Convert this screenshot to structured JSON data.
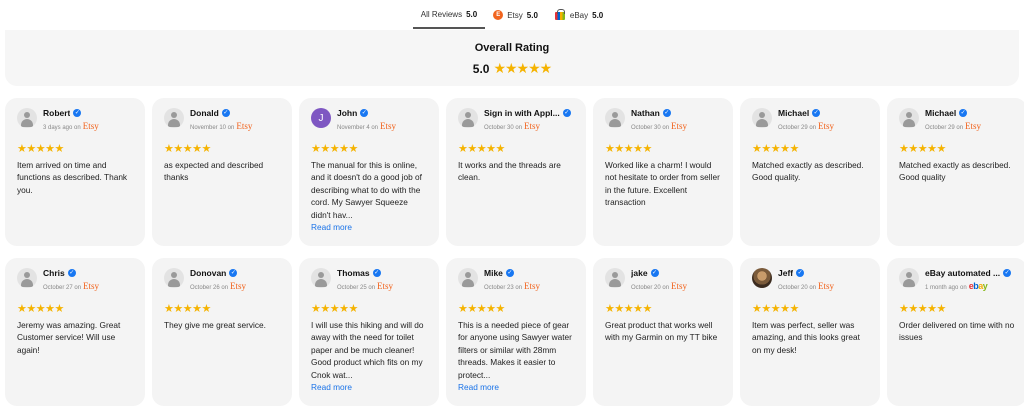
{
  "tabs": [
    {
      "label": "All Reviews",
      "score": "5.0",
      "icon": "none"
    },
    {
      "label": "Etsy",
      "score": "5.0",
      "icon": "etsy-icon"
    },
    {
      "label": "eBay",
      "score": "5.0",
      "icon": "ebay-icon"
    }
  ],
  "overall": {
    "title": "Overall Rating",
    "score": "5.0",
    "stars": "★★★★★"
  },
  "read_more_label": "Read more",
  "reviews": [
    {
      "name": "Robert",
      "date": "3 days ago on",
      "source": "Etsy",
      "stars": "★★★★★",
      "text": "Item arrived on time and functions as described. Thank you.",
      "avatar": "default"
    },
    {
      "name": "Donald",
      "date": "November 10 on",
      "source": "Etsy",
      "stars": "★★★★★",
      "text": "as expected and described thanks",
      "avatar": "default"
    },
    {
      "name": "John",
      "date": "November 4 on",
      "source": "Etsy",
      "stars": "★★★★★",
      "text": "The manual for this is online, and it doesn't do a good job of describing what to do with the cord. My Sawyer Squeeze didn't hav...",
      "avatar": "J"
    },
    {
      "name": "Sign in with Appl...",
      "date": "October 30 on",
      "source": "Etsy",
      "stars": "★★★★★",
      "text": "It works and the threads are clean.",
      "avatar": "default"
    },
    {
      "name": "Nathan",
      "date": "October 30 on",
      "source": "Etsy",
      "stars": "★★★★★",
      "text": "Worked like a charm! I would not hesitate to order from seller in the future. Excellent transaction",
      "avatar": "default"
    },
    {
      "name": "Michael",
      "date": "October 29 on",
      "source": "Etsy",
      "stars": "★★★★★",
      "text": "Matched exactly as described. Good quality.",
      "avatar": "default"
    },
    {
      "name": "Michael",
      "date": "October 29 on",
      "source": "Etsy",
      "stars": "★★★★★",
      "text": "Matched exactly as described. Good quality",
      "avatar": "default"
    },
    {
      "name": "Chris",
      "date": "October 27 on",
      "source": "Etsy",
      "stars": "★★★★★",
      "text": "Jeremy was amazing. Great Customer service! Will use again!",
      "avatar": "default"
    },
    {
      "name": "Donovan",
      "date": "October 26 on",
      "source": "Etsy",
      "stars": "★★★★★",
      "text": "They give me great service.",
      "avatar": "default"
    },
    {
      "name": "Thomas",
      "date": "October 25 on",
      "source": "Etsy",
      "stars": "★★★★★",
      "text": "I will use this hiking and will do away with the need for toilet paper and be much cleaner! Good product which fits on my Cnok wat...",
      "avatar": "default"
    },
    {
      "name": "Mike",
      "date": "October 23 on",
      "source": "Etsy",
      "stars": "★★★★★",
      "text": "This is a needed piece of gear for anyone using Sawyer water filters or similar with 28mm threads. Makes it easier to protect...",
      "avatar": "default"
    },
    {
      "name": "jake",
      "date": "October 20 on",
      "source": "Etsy",
      "stars": "★★★★★",
      "text": "Great product that works well with my Garmin on my TT bike",
      "avatar": "default"
    },
    {
      "name": "Jeff",
      "date": "October 20 on",
      "source": "Etsy",
      "stars": "★★★★★",
      "text": "Item was perfect, seller was amazing, and this looks great on my desk!",
      "avatar": "photo"
    },
    {
      "name": "eBay automated ...",
      "date": "1 month ago on",
      "source": "eBay",
      "stars": "★★★★★",
      "text": "Order delivered on time with no issues",
      "avatar": "default"
    }
  ]
}
